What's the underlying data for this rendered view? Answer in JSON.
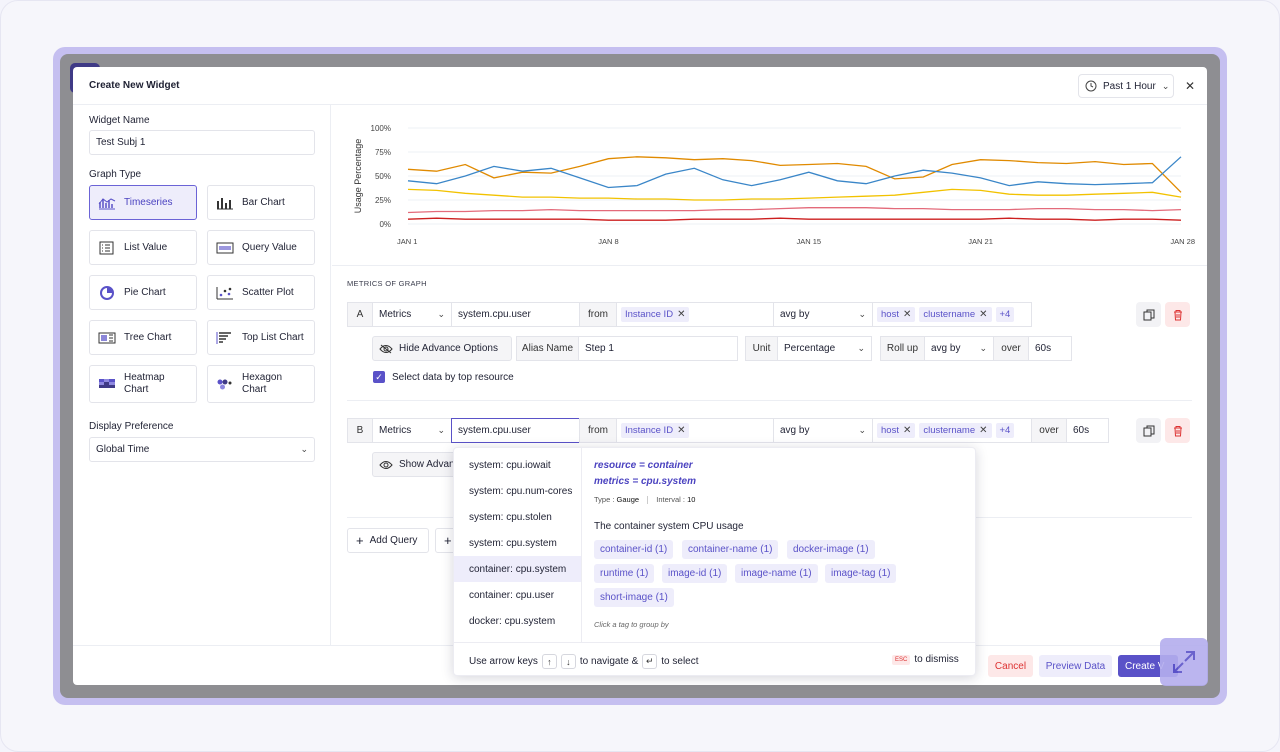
{
  "modal": {
    "title": "Create New Widget",
    "time_range": "Past 1 Hour"
  },
  "left": {
    "widget_name_label": "Widget Name",
    "widget_name_value": "Test Subj 1",
    "graph_type_label": "Graph Type",
    "graph_types": [
      {
        "label": "Timeseries",
        "icon": "timeseries-icon",
        "active": true
      },
      {
        "label": "Bar Chart",
        "icon": "bar-chart-icon"
      },
      {
        "label": "List Value",
        "icon": "list-value-icon"
      },
      {
        "label": "Query Value",
        "icon": "query-value-icon"
      },
      {
        "label": "Pie Chart",
        "icon": "pie-chart-icon"
      },
      {
        "label": "Scatter Plot",
        "icon": "scatter-plot-icon"
      },
      {
        "label": "Tree Chart",
        "icon": "tree-chart-icon"
      },
      {
        "label": "Top List Chart",
        "icon": "top-list-chart-icon"
      },
      {
        "label": "Heatmap Chart",
        "icon": "heatmap-chart-icon"
      },
      {
        "label": "Hexagon Chart",
        "icon": "hexagon-chart-icon"
      }
    ],
    "display_pref_label": "Display Preference",
    "display_pref_value": "Global Time"
  },
  "chart_data": {
    "type": "line",
    "ylabel": "Usage Percentage",
    "y_ticks": [
      "100%",
      "75%",
      "50%",
      "25%",
      "0%"
    ],
    "ylim": [
      0,
      100
    ],
    "x_ticks": [
      "JAN 1",
      "JAN 8",
      "JAN 15",
      "JAN 21",
      "JAN 28"
    ],
    "x": [
      1,
      2,
      3,
      4,
      5,
      6,
      7,
      8,
      9,
      10,
      11,
      12,
      13,
      14,
      15,
      16,
      17,
      18,
      19,
      20,
      21,
      22,
      23,
      24,
      25,
      26,
      27,
      28
    ],
    "series": [
      {
        "color": "#e08a00",
        "values": [
          57,
          55,
          62,
          48,
          54,
          53,
          60,
          68,
          70,
          69,
          67,
          68,
          66,
          61,
          62,
          63,
          60,
          47,
          49,
          62,
          67,
          66,
          64,
          63,
          65,
          62,
          63,
          33
        ]
      },
      {
        "color": "#3a86c8",
        "values": [
          45,
          42,
          50,
          60,
          55,
          58,
          48,
          38,
          40,
          52,
          58,
          46,
          40,
          46,
          54,
          45,
          42,
          50,
          56,
          53,
          48,
          40,
          44,
          42,
          41,
          42,
          43,
          70
        ]
      },
      {
        "color": "#f2c200",
        "values": [
          36,
          35,
          32,
          30,
          28,
          28,
          27,
          27,
          26,
          26,
          25,
          25,
          26,
          26,
          27,
          28,
          29,
          30,
          33,
          36,
          35,
          31,
          30,
          30,
          31,
          32,
          33,
          28
        ]
      },
      {
        "color": "#e36a7a",
        "values": [
          12,
          13,
          13,
          14,
          14,
          15,
          14,
          14,
          14,
          14,
          14,
          15,
          15,
          16,
          17,
          17,
          17,
          16,
          16,
          15,
          15,
          15,
          16,
          16,
          15,
          15,
          14,
          15
        ]
      },
      {
        "color": "#cc1f1f",
        "values": [
          5,
          6,
          5,
          5,
          5,
          5,
          5,
          4,
          4,
          4,
          5,
          5,
          5,
          6,
          5,
          5,
          5,
          5,
          5,
          5,
          5,
          6,
          5,
          5,
          4,
          5,
          5,
          4
        ]
      }
    ]
  },
  "metrics": {
    "section_title": "METRICS OF GRAPH",
    "query_a": {
      "letter": "A",
      "source": "Metrics",
      "metric": "system.cpu.user",
      "from_label": "from",
      "from_tag": "Instance ID",
      "agg": "avg by",
      "group_tags": [
        "host",
        "clustername"
      ],
      "more": "+4"
    },
    "advance": {
      "hide_label": "Hide Advance Options",
      "alias_label": "Alias Name",
      "alias_value": "Step 1",
      "unit_label": "Unit",
      "unit_value": "Percentage",
      "rollup_label": "Roll up",
      "rollup_agg": "avg by",
      "over_label": "over",
      "over_value": "60s",
      "top_resource_label": "Select data by top resource"
    },
    "query_b": {
      "letter": "B",
      "source": "Metrics",
      "metric": "system.cpu.user",
      "from_label": "from",
      "from_tag": "Instance ID",
      "agg": "avg by",
      "group_tags": [
        "host",
        "clustername"
      ],
      "more": "+4",
      "over_label": "over",
      "over_value": "60s",
      "show_label": "Show Advan"
    },
    "add_query": "Add Query"
  },
  "dropdown": {
    "items": [
      "system: cpu.iowait",
      "system: cpu.num-cores",
      "system: cpu.stolen",
      "system: cpu.system",
      "container: cpu.system",
      "container: cpu.user",
      "docker: cpu.system"
    ],
    "highlighted": 4,
    "detail": {
      "resource": "resource = container",
      "metrics": "metrics = cpu.system",
      "type_label": "Type :",
      "type_value": "Gauge",
      "interval_label": "Interval :",
      "interval_value": "10",
      "description": "The container system CPU usage",
      "tags": [
        "container-id (1)",
        "container-name (1)",
        "docker-image (1)",
        "runtime (1)",
        "image-id (1)",
        "image-name (1)",
        "image-tag (1)",
        "short-image (1)"
      ],
      "hint": "Click a tag to group by"
    },
    "footer": {
      "use_arrow": "Use arrow keys",
      "navigate": "to navigate &",
      "select": "to select",
      "esc": "ESC",
      "dismiss": "to dismiss"
    }
  },
  "footer": {
    "cancel": "Cancel",
    "preview": "Preview Data",
    "create": "Create V"
  }
}
